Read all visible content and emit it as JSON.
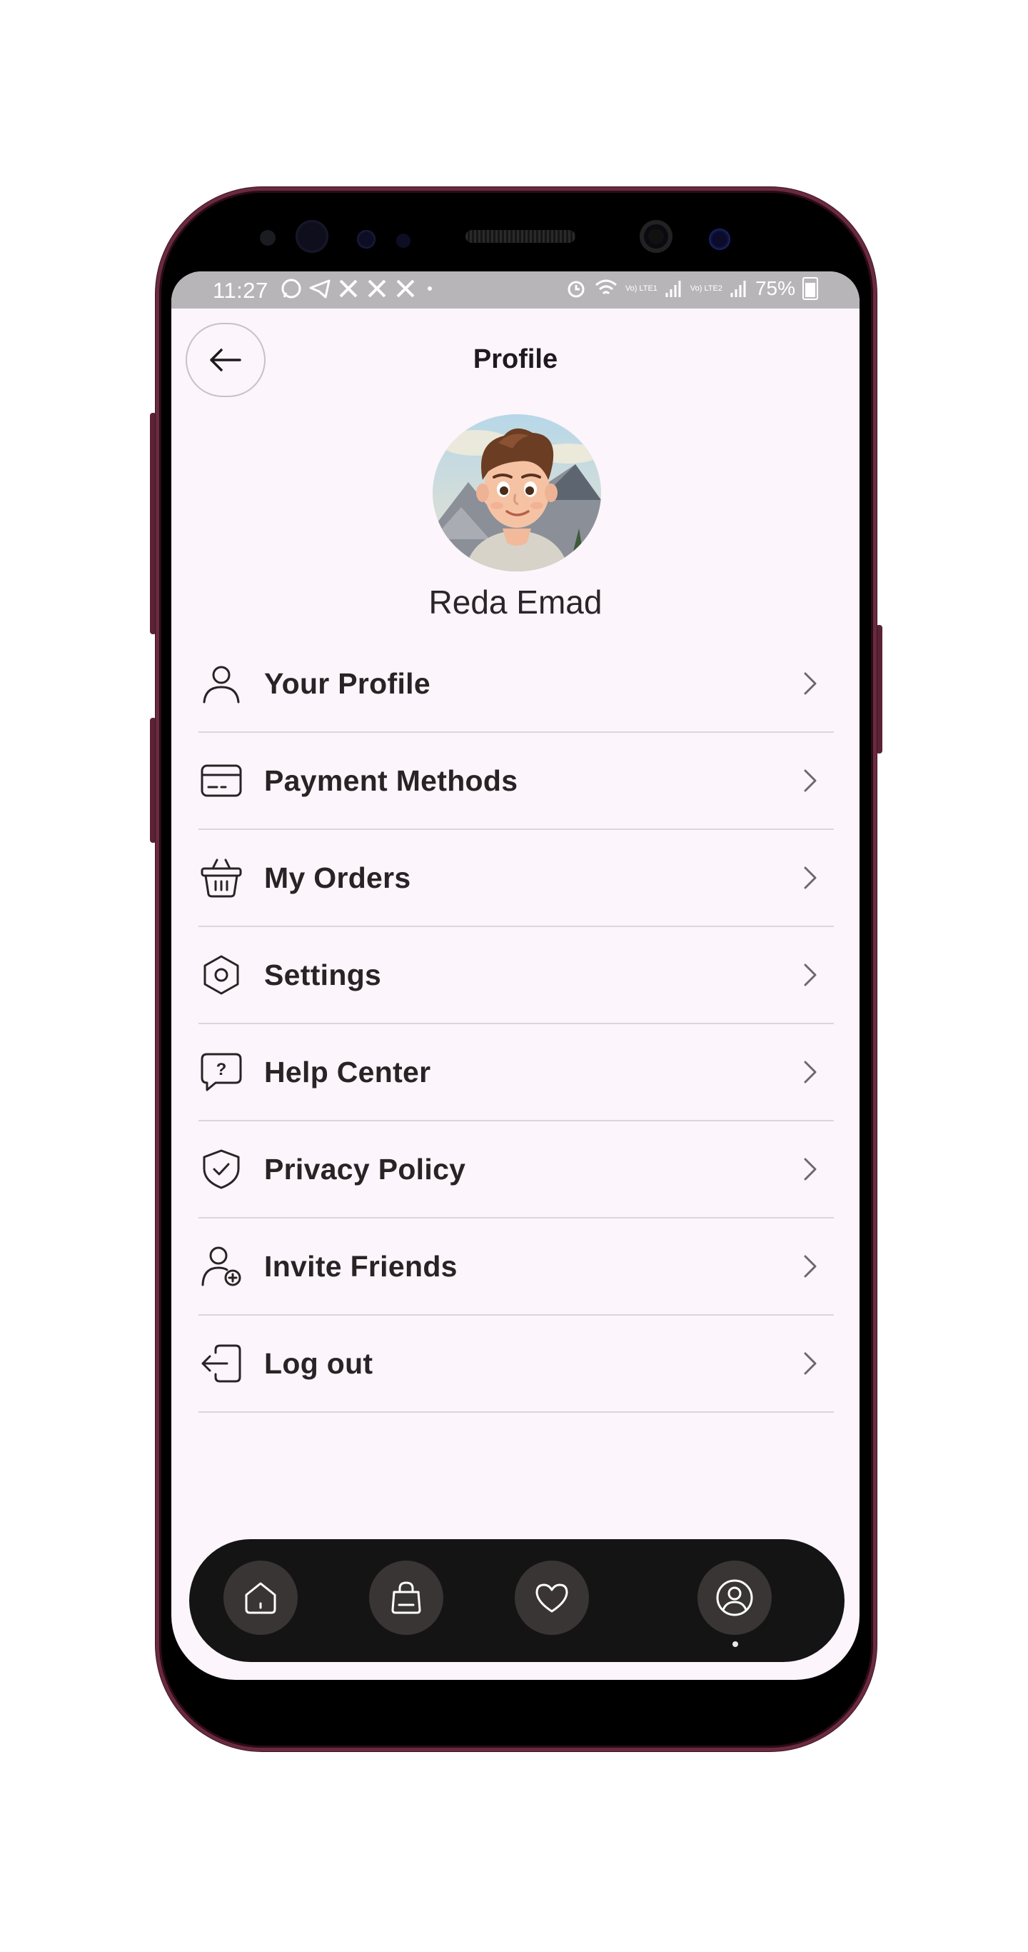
{
  "status_bar": {
    "time": "11:27",
    "battery": "75%",
    "lte1": "Vo) LTE1",
    "lte2": "Vo) LTE2"
  },
  "header": {
    "title": "Profile",
    "back_icon": "arrow-left-icon"
  },
  "profile": {
    "name": "Reda Emad"
  },
  "menu": {
    "items": [
      {
        "label": "Your Profile",
        "icon": "user-icon"
      },
      {
        "label": "Payment Methods",
        "icon": "credit-card-icon"
      },
      {
        "label": "My Orders",
        "icon": "basket-icon"
      },
      {
        "label": "Settings",
        "icon": "settings-hexagon-icon"
      },
      {
        "label": "Help Center",
        "icon": "help-chat-icon"
      },
      {
        "label": "Privacy Policy",
        "icon": "shield-check-icon"
      },
      {
        "label": "Invite Friends",
        "icon": "user-add-icon"
      },
      {
        "label": "Log out",
        "icon": "logout-icon"
      }
    ]
  },
  "bottom_nav": {
    "items": [
      "home-icon",
      "shopping-bag-icon",
      "heart-icon",
      "profile-circle-icon"
    ],
    "active": "profile-circle-icon"
  },
  "colors": {
    "screen_bg": "#fcf5fb",
    "nav_bg": "#141414",
    "nav_button": "#3a3535",
    "text": "#2a2326",
    "divider": "#dcd6db"
  }
}
